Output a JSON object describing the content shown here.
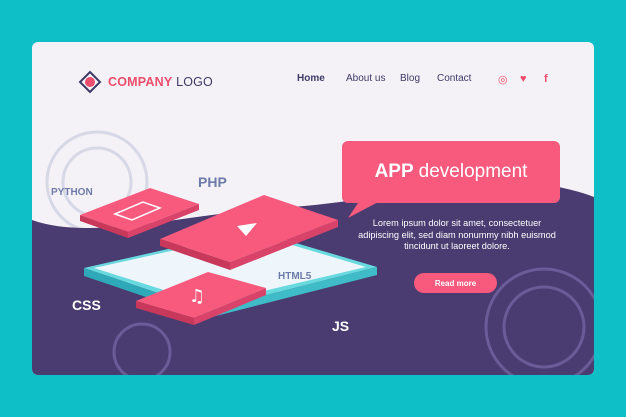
{
  "logo": {
    "company": "COMPANY",
    "logo": "LOGO"
  },
  "nav": {
    "home": "Home",
    "about": "About us",
    "blog": "Blog",
    "contact": "Contact"
  },
  "social": [
    "instagram-icon",
    "twitter-icon",
    "facebook-icon"
  ],
  "hero": {
    "title_strong": "APP",
    "title_rest": "development",
    "body": "Lorem ipsum dolor sit amet, consectetuer adipiscing elit, sed diam nonummy nibh euismod tincidunt ut laoreet dolore.",
    "cta": "Read more"
  },
  "labels": {
    "python": "PYTHON",
    "php": "PHP",
    "html5": "HTML5",
    "css": "CSS",
    "js": "JS"
  },
  "colors": {
    "accent": "#f75a7d",
    "dark": "#3e3a66",
    "teal": "#0fbfc7",
    "background": "#f4f2f7",
    "panel": "#fdfcfe"
  }
}
